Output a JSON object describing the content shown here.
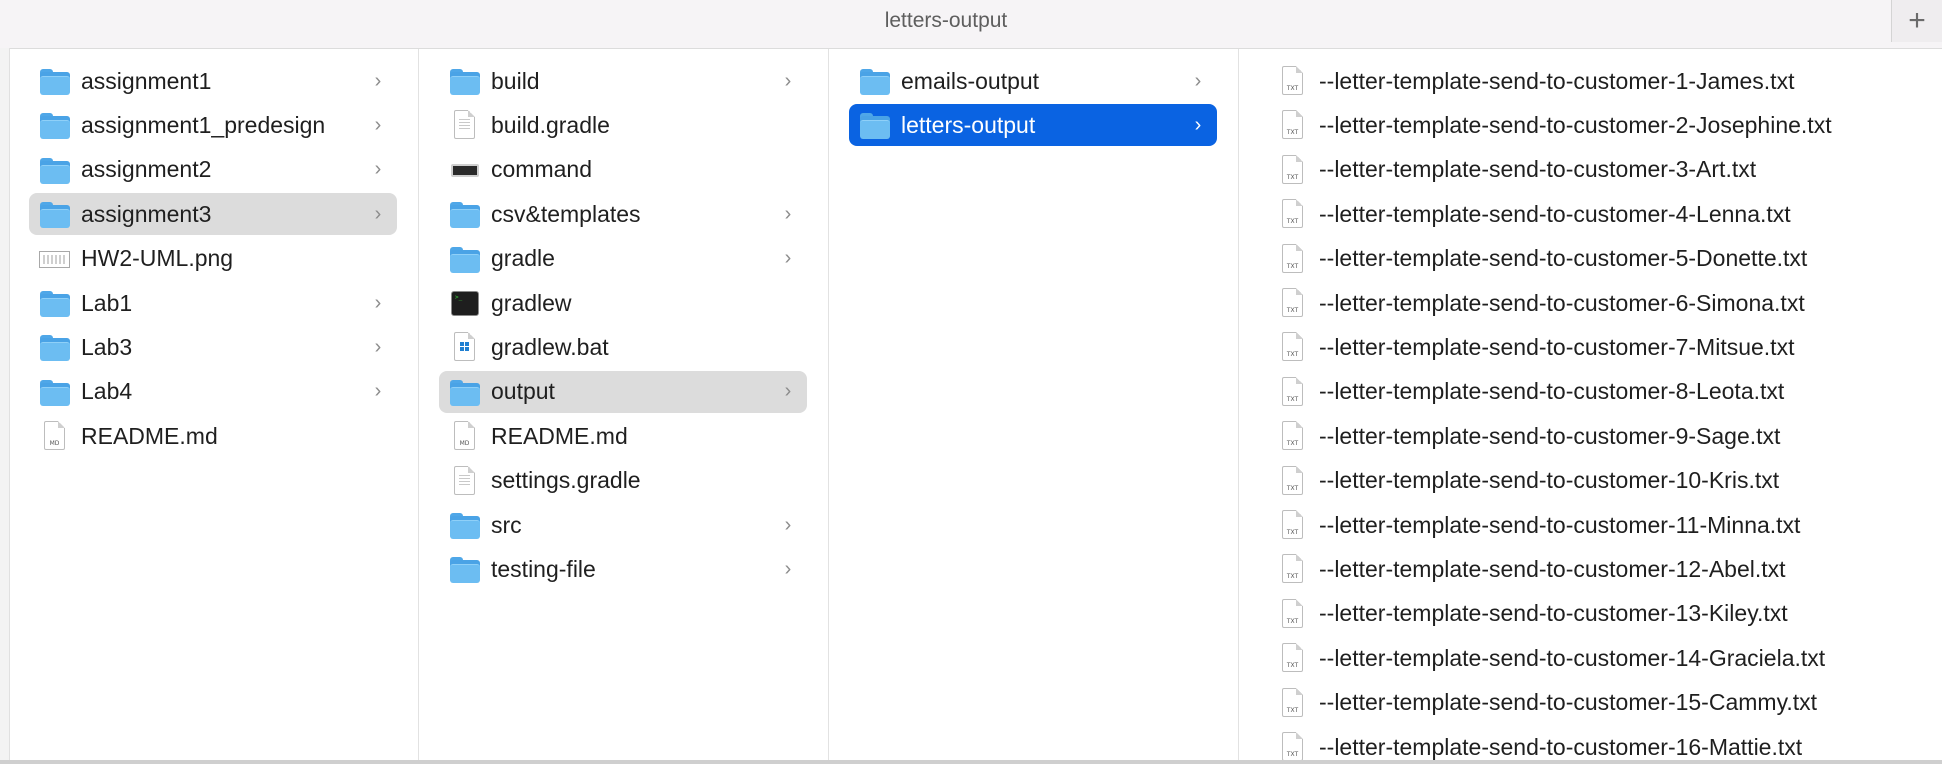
{
  "window": {
    "title": "letters-output",
    "new_tab_symbol": "+"
  },
  "columns": [
    {
      "items": [
        {
          "name": "assignment1",
          "type": "folder",
          "has_children": true,
          "state": ""
        },
        {
          "name": "assignment1_predesign",
          "type": "folder",
          "has_children": true,
          "state": ""
        },
        {
          "name": "assignment2",
          "type": "folder",
          "has_children": true,
          "state": ""
        },
        {
          "name": "assignment3",
          "type": "folder",
          "has_children": true,
          "state": "selected-gray"
        },
        {
          "name": "HW2-UML.png",
          "type": "image",
          "has_children": false,
          "state": ""
        },
        {
          "name": "Lab1",
          "type": "folder",
          "has_children": true,
          "state": ""
        },
        {
          "name": "Lab3",
          "type": "folder",
          "has_children": true,
          "state": ""
        },
        {
          "name": "Lab4",
          "type": "folder",
          "has_children": true,
          "state": ""
        },
        {
          "name": "README.md",
          "type": "doc-md",
          "has_children": false,
          "state": ""
        }
      ]
    },
    {
      "items": [
        {
          "name": "build",
          "type": "folder",
          "has_children": true,
          "state": ""
        },
        {
          "name": "build.gradle",
          "type": "doc",
          "has_children": false,
          "state": ""
        },
        {
          "name": "command",
          "type": "terminal-light",
          "has_children": false,
          "state": ""
        },
        {
          "name": "csv&templates",
          "type": "folder",
          "has_children": true,
          "state": ""
        },
        {
          "name": "gradle",
          "type": "folder",
          "has_children": true,
          "state": ""
        },
        {
          "name": "gradlew",
          "type": "terminal-dark",
          "has_children": false,
          "state": ""
        },
        {
          "name": "gradlew.bat",
          "type": "bat",
          "has_children": false,
          "state": ""
        },
        {
          "name": "output",
          "type": "folder",
          "has_children": true,
          "state": "selected-gray"
        },
        {
          "name": "README.md",
          "type": "doc-md",
          "has_children": false,
          "state": ""
        },
        {
          "name": "settings.gradle",
          "type": "doc",
          "has_children": false,
          "state": ""
        },
        {
          "name": "src",
          "type": "folder",
          "has_children": true,
          "state": ""
        },
        {
          "name": "testing-file",
          "type": "folder",
          "has_children": true,
          "state": ""
        }
      ]
    },
    {
      "items": [
        {
          "name": "emails-output",
          "type": "folder",
          "has_children": true,
          "state": ""
        },
        {
          "name": "letters-output",
          "type": "folder",
          "has_children": true,
          "state": "selected-blue"
        }
      ]
    },
    {
      "items": [
        {
          "name": "--letter-template-send-to-customer-1-James.txt",
          "type": "doc-txt",
          "has_children": false,
          "state": ""
        },
        {
          "name": "--letter-template-send-to-customer-2-Josephine.txt",
          "type": "doc-txt",
          "has_children": false,
          "state": ""
        },
        {
          "name": "--letter-template-send-to-customer-3-Art.txt",
          "type": "doc-txt",
          "has_children": false,
          "state": ""
        },
        {
          "name": "--letter-template-send-to-customer-4-Lenna.txt",
          "type": "doc-txt",
          "has_children": false,
          "state": ""
        },
        {
          "name": "--letter-template-send-to-customer-5-Donette.txt",
          "type": "doc-txt",
          "has_children": false,
          "state": ""
        },
        {
          "name": "--letter-template-send-to-customer-6-Simona.txt",
          "type": "doc-txt",
          "has_children": false,
          "state": ""
        },
        {
          "name": "--letter-template-send-to-customer-7-Mitsue.txt",
          "type": "doc-txt",
          "has_children": false,
          "state": ""
        },
        {
          "name": "--letter-template-send-to-customer-8-Leota.txt",
          "type": "doc-txt",
          "has_children": false,
          "state": ""
        },
        {
          "name": "--letter-template-send-to-customer-9-Sage.txt",
          "type": "doc-txt",
          "has_children": false,
          "state": ""
        },
        {
          "name": "--letter-template-send-to-customer-10-Kris.txt",
          "type": "doc-txt",
          "has_children": false,
          "state": ""
        },
        {
          "name": "--letter-template-send-to-customer-11-Minna.txt",
          "type": "doc-txt",
          "has_children": false,
          "state": ""
        },
        {
          "name": "--letter-template-send-to-customer-12-Abel.txt",
          "type": "doc-txt",
          "has_children": false,
          "state": ""
        },
        {
          "name": "--letter-template-send-to-customer-13-Kiley.txt",
          "type": "doc-txt",
          "has_children": false,
          "state": ""
        },
        {
          "name": "--letter-template-send-to-customer-14-Graciela.txt",
          "type": "doc-txt",
          "has_children": false,
          "state": ""
        },
        {
          "name": "--letter-template-send-to-customer-15-Cammy.txt",
          "type": "doc-txt",
          "has_children": false,
          "state": ""
        },
        {
          "name": "--letter-template-send-to-customer-16-Mattie.txt",
          "type": "doc-txt",
          "has_children": false,
          "state": ""
        }
      ]
    }
  ],
  "icons": {
    "folder": "folder-icon",
    "doc": "document-icon",
    "doc-md": "markdown-file-icon",
    "doc-txt": "text-file-icon",
    "image": "image-file-icon",
    "terminal-light": "executable-icon",
    "terminal-dark": "terminal-script-icon",
    "bat": "batch-file-icon",
    "chevron": "chevron-right-icon"
  },
  "file_extension_labels": {
    "doc-md": "MD",
    "doc-txt": "TXT"
  },
  "chevron_glyph": "›",
  "colors": {
    "selection_blue": "#0a63e2",
    "selection_gray": "#dcdcdc",
    "folder_blue": "#6cbdf2",
    "titlebar_bg": "#f6f4f6"
  }
}
